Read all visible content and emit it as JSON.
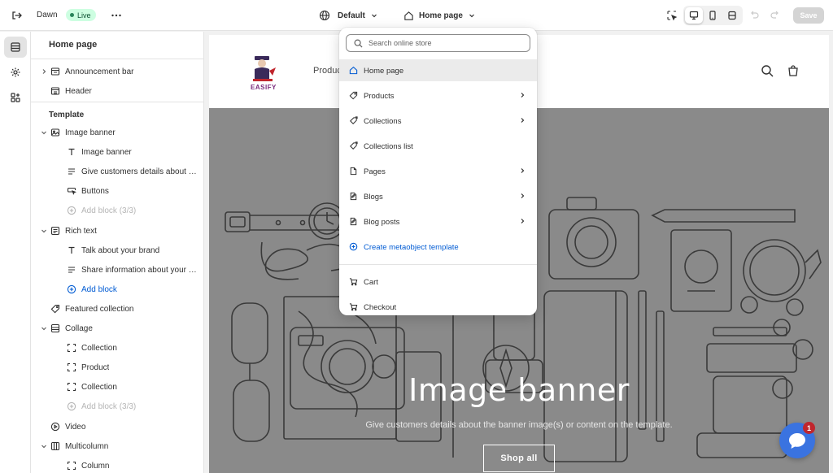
{
  "topbar": {
    "theme_name": "Dawn",
    "status_badge": "Live",
    "template_selector": "Default",
    "page_selector": "Home page",
    "save_label": "Save"
  },
  "sidebar": {
    "title": "Home page",
    "header_items": [
      {
        "label": "Announcement bar",
        "icon": "announcement-bar-icon",
        "expandable": true
      },
      {
        "label": "Header",
        "icon": "header-icon",
        "expandable": false
      }
    ],
    "template_label": "Template",
    "sections": [
      {
        "label": "Image banner",
        "icon": "image-banner-icon",
        "expanded": true,
        "blocks": [
          {
            "label": "Image banner",
            "icon": "text-icon"
          },
          {
            "label": "Give customers details about the banner image(s) or content on the template.",
            "icon": "paragraph-icon"
          },
          {
            "label": "Buttons",
            "icon": "button-icon"
          },
          {
            "label": "Add block (3/3)",
            "icon": "add-circle-icon",
            "kind": "muted"
          }
        ]
      },
      {
        "label": "Rich text",
        "icon": "rich-text-icon",
        "expanded": true,
        "blocks": [
          {
            "label": "Talk about your brand",
            "icon": "text-icon"
          },
          {
            "label": "Share information about your brand with your customers.",
            "icon": "paragraph-icon"
          },
          {
            "label": "Add block",
            "icon": "add-circle-icon",
            "kind": "blue"
          }
        ]
      },
      {
        "label": "Featured collection",
        "icon": "tag-icon",
        "expanded": false,
        "blocks": []
      },
      {
        "label": "Collage",
        "icon": "collage-icon",
        "expanded": true,
        "blocks": [
          {
            "label": "Collection",
            "icon": "frame-icon"
          },
          {
            "label": "Product",
            "icon": "frame-icon"
          },
          {
            "label": "Collection",
            "icon": "frame-icon"
          },
          {
            "label": "Add block (3/3)",
            "icon": "add-circle-icon",
            "kind": "muted"
          }
        ]
      },
      {
        "label": "Video",
        "icon": "play-icon",
        "expanded": false,
        "blocks": []
      },
      {
        "label": "Multicolumn",
        "icon": "columns-icon",
        "expanded": true,
        "blocks": [
          {
            "label": "Column",
            "icon": "frame-icon"
          }
        ]
      }
    ]
  },
  "preview": {
    "logo_text": "EASIFY",
    "nav_first": "Produc",
    "banner_heading": "Image banner",
    "banner_subtext": "Give customers details about the banner image(s) or content on the template.",
    "banner_button": "Shop all"
  },
  "dropdown": {
    "search_placeholder": "Search online store",
    "items": [
      {
        "label": "Home page",
        "icon": "home-icon",
        "arrow": false,
        "active": true
      },
      {
        "label": "Products",
        "icon": "tag-icon",
        "arrow": true
      },
      {
        "label": "Collections",
        "icon": "collection-icon",
        "arrow": true
      },
      {
        "label": "Collections list",
        "icon": "collection-icon",
        "arrow": false
      },
      {
        "label": "Pages",
        "icon": "page-icon",
        "arrow": true
      },
      {
        "label": "Blogs",
        "icon": "blog-icon",
        "arrow": true
      },
      {
        "label": "Blog posts",
        "icon": "blog-icon",
        "arrow": true
      },
      {
        "label": "Create metaobject template",
        "icon": "add-circle-icon",
        "arrow": false,
        "kind": "blue"
      }
    ],
    "more_items": [
      {
        "label": "Cart",
        "icon": "cart-icon"
      },
      {
        "label": "Checkout",
        "icon": "cart-icon"
      }
    ]
  },
  "chat": {
    "badge_count": "1"
  },
  "colors": {
    "accent_blue": "#005bd3",
    "live_bg": "#cdfee1",
    "live_dot": "#29845a",
    "chat_blue": "#3a73e0"
  }
}
